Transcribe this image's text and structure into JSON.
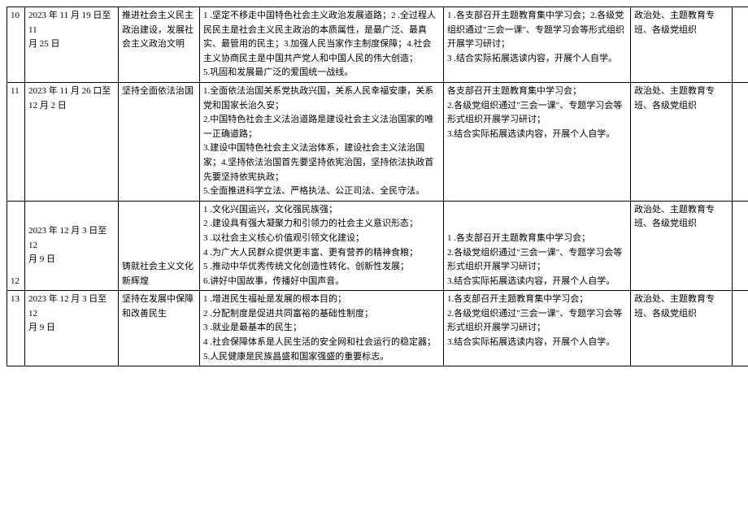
{
  "rows": [
    {
      "num": "10",
      "date": "2023 年 11 月 19 日至11\n月 25 日",
      "topic": "推进社会主义民主政治建设，发展社会主义政治文明",
      "content": "1 .坚定不移走中国特色社会主义政治发展道路；2 .全过程人民民主是社会主义民主政治的本质属性，是最广泛、最真实、最管用的民主；3.加强人民当家作主制度保障；4.社会主义协商民主是中国共产党人和中国人民的伟大创造；\n5.巩固和发展最广泛的爱国统一战线。",
      "method": "1 .各支部召开主题教育集中学习会；2.各级党组织通过\"三会一课\"、专题学习会等形式组织开展学习研讨；\n3 .结合实际拓展选读内容，开展个人自学。",
      "resp": "政治处、主题教育专班、各级党组织"
    },
    {
      "num": "11",
      "date": "2023 年 11 月 26 口至12 月 2 日",
      "topic": "坚持全面依法治国",
      "content": "1.全面依法治国关系党执政兴国，关系人民幸福安康，关系党和国家长治久安；\n2.中国特色社会主义法治道路是建设社会主义法治国家的唯一正确道路；\n3.建设中国特色社会主义法治体系，建设社会主义法治国家；4.坚持依法治国首先要坚持依宪治国，坚持依法执政首先要坚持依宪执政；\n5.全面推进科学立法、严格执法、公正司法、全民守法。",
      "method": "各支部召开主题教育集中学习会；\n2.各级党组织通过\"三会一课\"、专题学习会等形式组织开展学习研讨；\n3.结合实际拓展选读内容，开展个人自学。",
      "resp": "政治处、主题教育专班、各级党组织"
    },
    {
      "num": "12",
      "date": "2023 年 12 月 3 日至12\n月 9 日",
      "topic": "铸就社会主义文化新辉煌",
      "content": "1 .文化兴国运兴，文化强民族强；\n2 .建设具有强大凝聚力和引领力的社会主义意识形态；\n3 .以社会主义核心价值观引领文化建设；\n4 .为广大人民群众提供更丰富、更有营养的精神食粮；\n5 .推动中华优秀传统文化创造性转化、创新性发展；\n6.讲好中国故事，传播好中国声音。",
      "method": "1 .各支部召开主题教育集中学习会；\n2.各级党组织通过\"三会一课\"、专题学习会等形式组织开展学习研讨；\n3.结合实际拓展选读内容，开展个人自学。",
      "resp": "政治处、主题教育专班、各级党组织"
    },
    {
      "num": "13",
      "date": "2023 年 12 月 3 日至12\n月 9 日",
      "topic": "坚持在发展中保障和改善民生",
      "content": "1 .增进民生福祉是发展的根本目的；\n2 .分配制度是促进共同富裕的基础性制度；\n3 .就业是最基本的民生；\n4 .社会保障体系是人民生活的安全网和社会运行的稳定器；\n5.人民健康是民族昌盛和国家强盛的重要标志。",
      "method": "1.各支部召开主题教育集中学习会；\n2.各级党组织通过\"三会一课\"、专题学习会等形式组织开展学习研讨；\n3.结合实际拓展选读内容，开展个人自学。",
      "resp": "政治处、主题教育专班、各级党组织"
    }
  ]
}
